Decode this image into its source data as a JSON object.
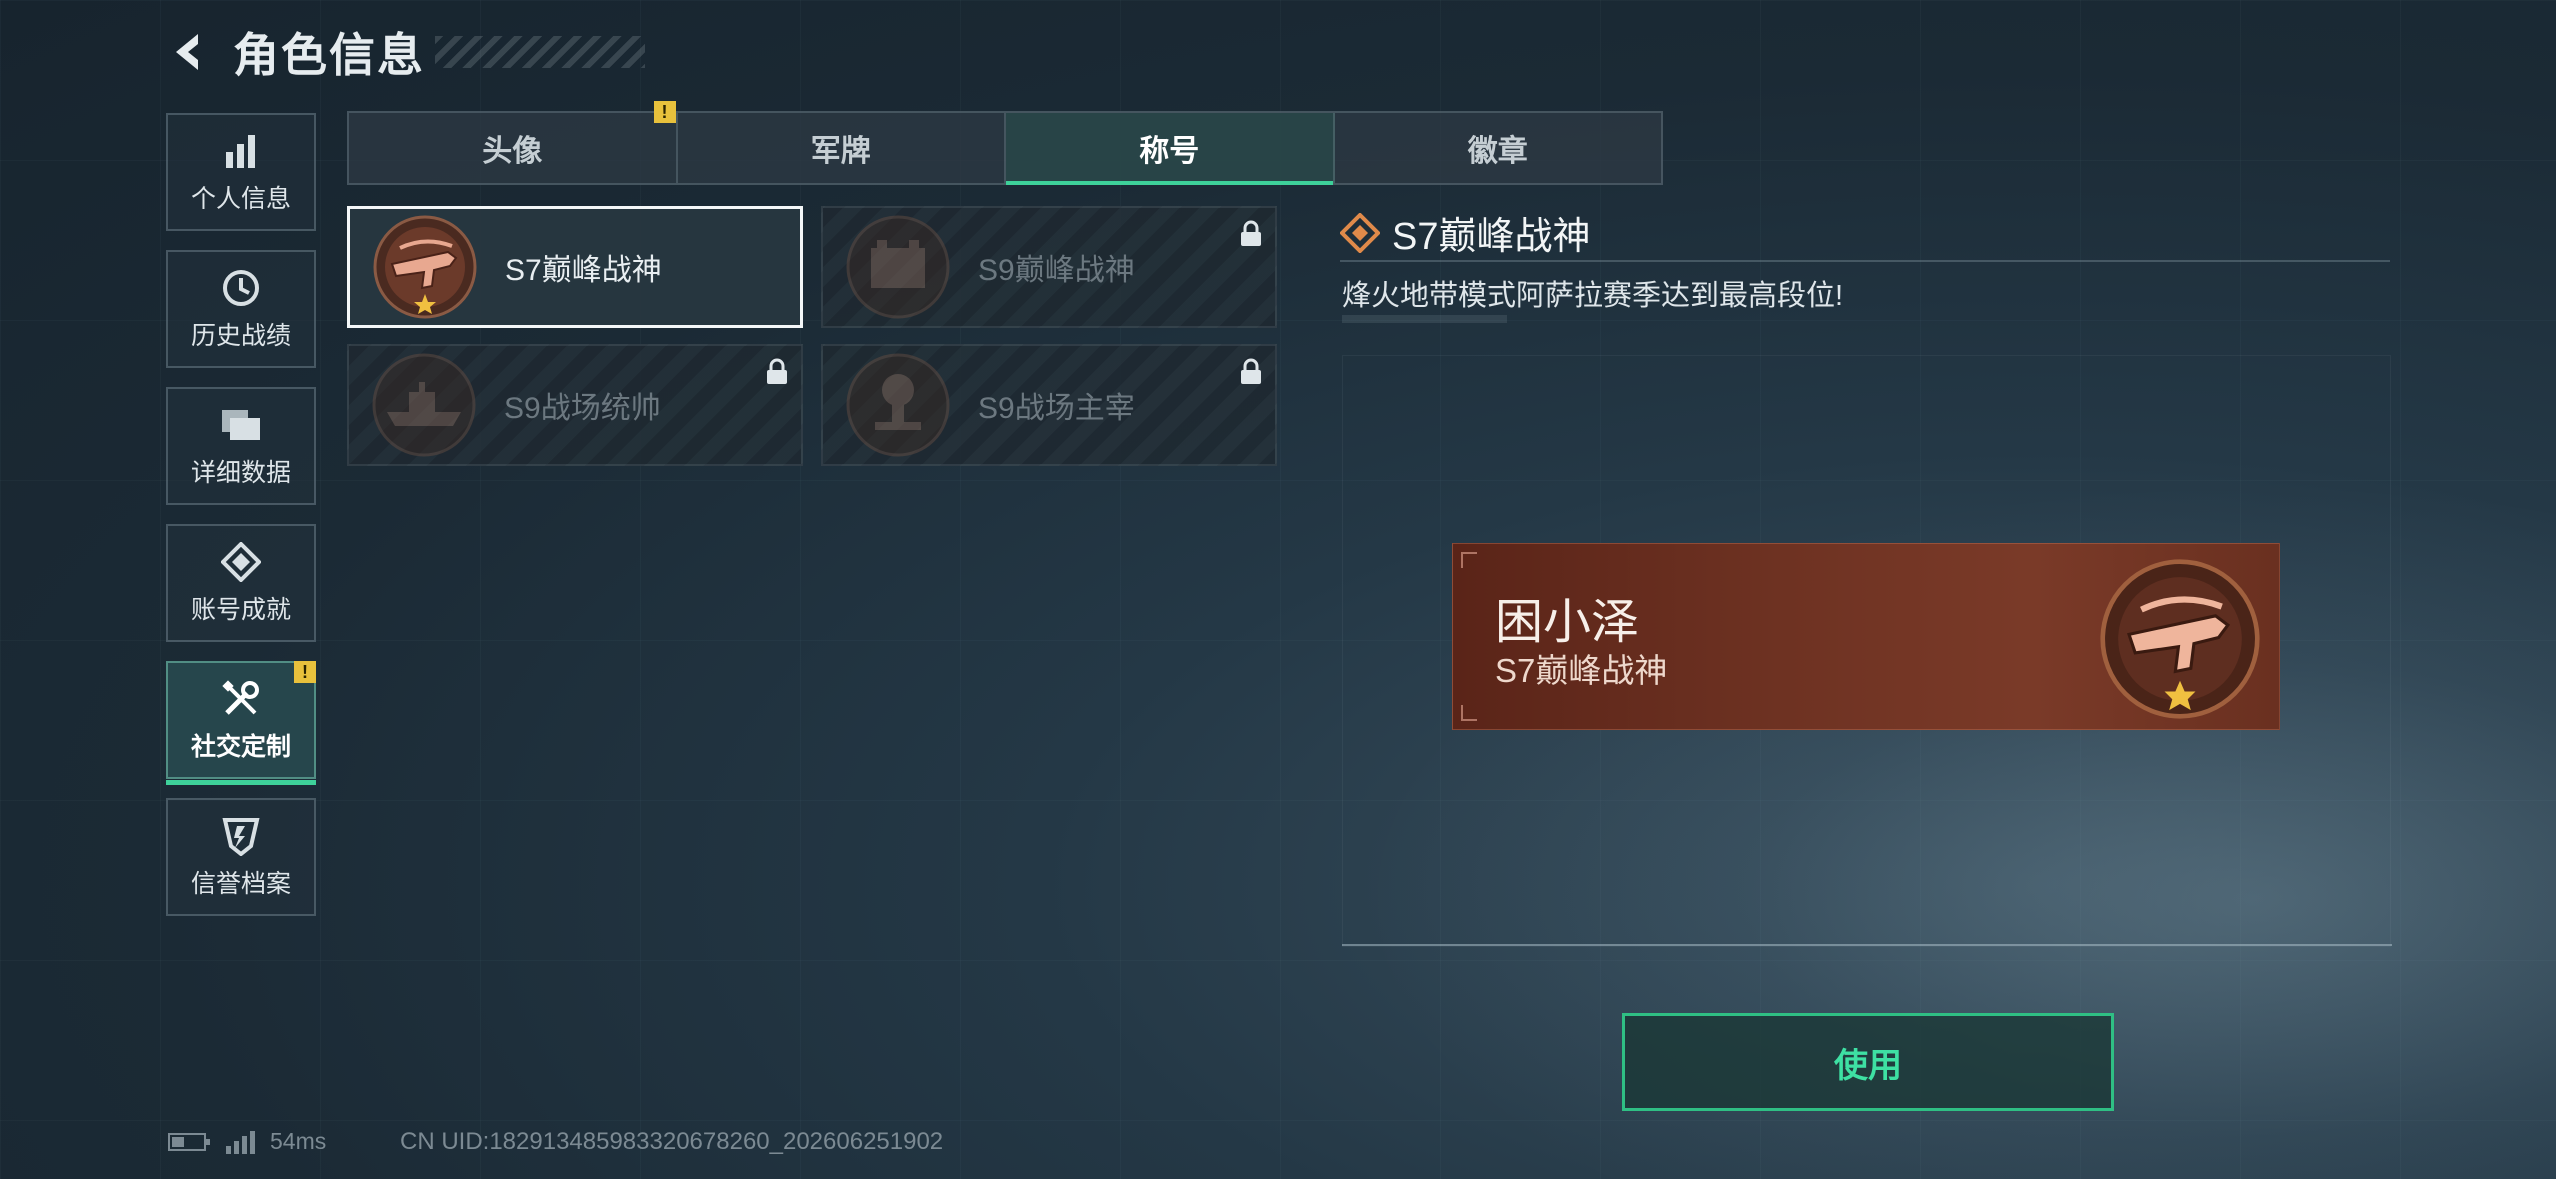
{
  "header": {
    "title": "角色信息"
  },
  "sidebar": {
    "items": [
      {
        "label": "个人信息",
        "icon": "bar-chart-icon"
      },
      {
        "label": "历史战绩",
        "icon": "history-clock-icon"
      },
      {
        "label": "详细数据",
        "icon": "folder-icon"
      },
      {
        "label": "账号成就",
        "icon": "achievement-diamond-icon"
      },
      {
        "label": "社交定制",
        "icon": "tools-icon",
        "active": true,
        "badge": "!"
      },
      {
        "label": "信誉档案",
        "icon": "credit-shield-icon"
      }
    ]
  },
  "tabs": [
    {
      "label": "头像",
      "badge": "!"
    },
    {
      "label": "军牌"
    },
    {
      "label": "称号",
      "active": true
    },
    {
      "label": "徽章"
    }
  ],
  "titles": [
    {
      "label": "S7巅峰战神",
      "selected": true,
      "locked": false
    },
    {
      "label": "S9巅峰战神",
      "locked": true
    },
    {
      "label": "S9战场统帅",
      "locked": true
    },
    {
      "label": "S9战场主宰",
      "locked": true
    }
  ],
  "detail": {
    "title": "S7巅峰战神",
    "description": "烽火地带模式阿萨拉赛季达到最高段位!"
  },
  "nameplate": {
    "player_name": "困小泽",
    "title": "S7巅峰战神"
  },
  "use_button": {
    "label": "使用"
  },
  "status": {
    "ping": "54ms",
    "uid": "CN UID:1829134859833206782​60_202606251902"
  },
  "colors": {
    "accent_green": "#3ed19a",
    "warning_yellow": "#e8c13c",
    "nameplate_bg": "#6e3222"
  }
}
